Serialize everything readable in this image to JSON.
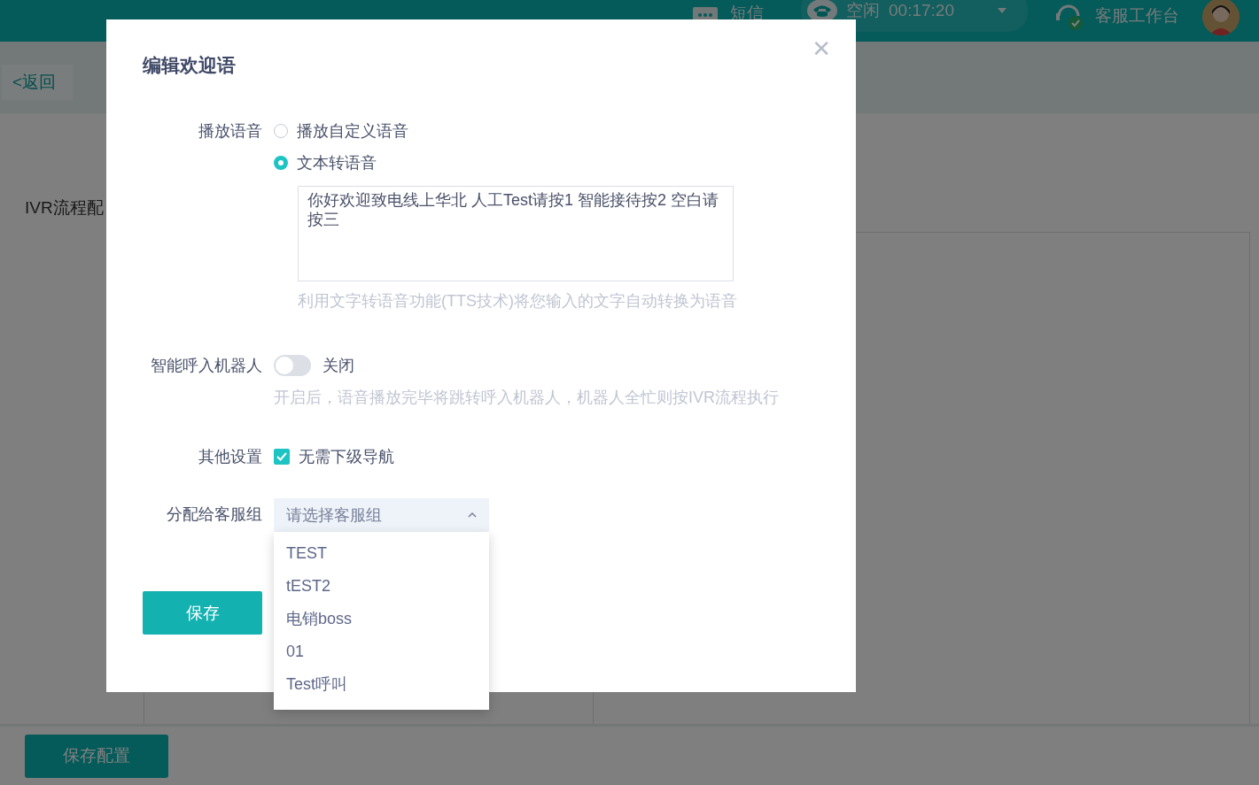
{
  "header": {
    "sms": "短信",
    "status": "空闲",
    "timer": "00:17:20",
    "workbench": "客服工作台"
  },
  "back_button": "<返回",
  "page_title": "IVR流程配",
  "save_config_button": "保存配置",
  "dialog": {
    "title": "编辑欢迎语",
    "close": "✕",
    "play_voice": {
      "label": "播放语音",
      "options": [
        {
          "label": "播放自定义语音",
          "selected": false
        },
        {
          "label": "文本转语音",
          "selected": true
        }
      ],
      "tts_text": "你好欢迎致电线上华北 人工Test请按1  智能接待按2 空白请按三",
      "hint": "利用文字转语音功能(TTS技术)将您输入的文字自动转换为语音"
    },
    "robot": {
      "label": "智能呼入机器人",
      "on": false,
      "state_text": "关闭",
      "hint": "开启后，语音播放完毕将跳转呼入机器人，机器人全忙则按IVR流程执行"
    },
    "other": {
      "label": "其他设置",
      "checkbox": {
        "label": "无需下级导航",
        "checked": true
      }
    },
    "group": {
      "label": "分配给客服组",
      "placeholder": "请选择客服组",
      "expanded": true,
      "options": [
        "TEST",
        "tEST2",
        "电销boss",
        "01",
        "Test呼叫"
      ]
    },
    "save_button": "保存"
  }
}
